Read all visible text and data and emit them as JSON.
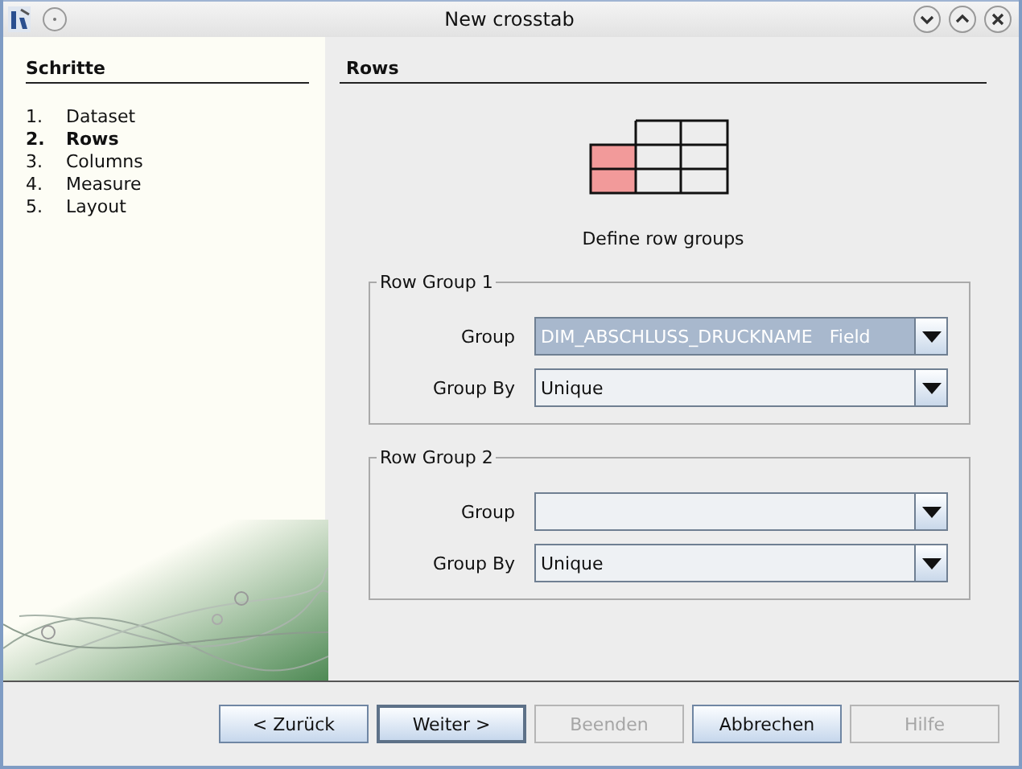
{
  "window": {
    "title": "New crosstab"
  },
  "steps": {
    "title": "Schritte",
    "items": [
      {
        "number": "1.",
        "label": "Dataset",
        "selected": false
      },
      {
        "number": "2.",
        "label": "Rows",
        "selected": true
      },
      {
        "number": "3.",
        "label": "Columns",
        "selected": false
      },
      {
        "number": "4.",
        "label": "Measure",
        "selected": false
      },
      {
        "number": "5.",
        "label": "Layout",
        "selected": false
      }
    ]
  },
  "page": {
    "title": "Rows",
    "caption": "Define row groups",
    "groups": [
      {
        "legend": "Row Group 1",
        "fields": [
          {
            "label": "Group",
            "value": "DIM_ABSCHLUSS_DRUCKNAME   Field",
            "focused": true
          },
          {
            "label": "Group By",
            "value": "Unique",
            "focused": false
          }
        ]
      },
      {
        "legend": "Row Group 2",
        "fields": [
          {
            "label": "Group",
            "focused": false
          },
          {
            "label": "Group By",
            "value": "Unique",
            "focused": false
          }
        ]
      }
    ]
  },
  "buttons": [
    {
      "label": "< Zurück",
      "disabled": false,
      "default": false
    },
    {
      "label": "Weiter >",
      "disabled": false,
      "default": true
    },
    {
      "label": "Beenden",
      "disabled": true,
      "default": false
    },
    {
      "label": "Abbrechen",
      "disabled": false,
      "default": false
    },
    {
      "label": "Hilfe",
      "disabled": true,
      "default": false
    }
  ]
}
